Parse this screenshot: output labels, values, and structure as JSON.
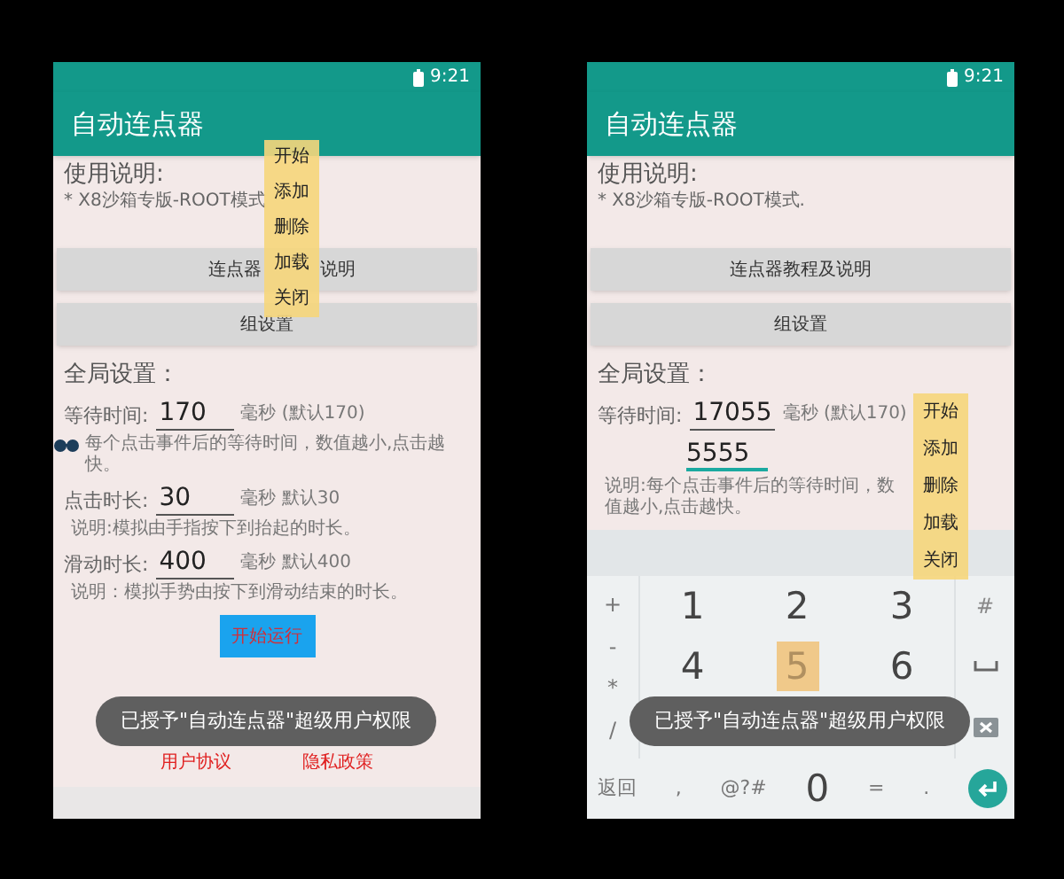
{
  "screens": [
    {
      "status_bar": {
        "time": "9:21"
      },
      "app_bar": {
        "title": "自动连点器"
      },
      "instructions": {
        "heading": "使用说明:",
        "text": "* X8沙箱专版-ROOT模式"
      },
      "buttons": [
        {
          "label_parts": [
            "连点器",
            "说明"
          ]
        },
        {
          "label_parts": [
            "组设置"
          ]
        }
      ],
      "section_title": "全局设置：",
      "settings": [
        {
          "label": "等待时间:",
          "value": "170",
          "unit": "毫秒 (默认170)",
          "note": "每个点击事件后的等待时间，数值越小,点击越快。"
        },
        {
          "label": "点击时长:",
          "value": "30",
          "unit": "毫秒 默认30",
          "note": "说明:模拟由手指按下到抬起的时长。"
        },
        {
          "label": "滑动时长:",
          "value": "400",
          "unit": "毫秒 默认400",
          "note": "说明：模拟手势由按下到滑动结束的时长。"
        }
      ],
      "start_button": "开始运行",
      "links": [
        "用户协议",
        "隐私政策"
      ],
      "float_menu": [
        "开始",
        "添加",
        "删除",
        "加载",
        "关闭"
      ],
      "toast": "已授予\"自动连点器\"超级用户权限"
    },
    {
      "status_bar": {
        "time": "9:21"
      },
      "app_bar": {
        "title": "自动连点器"
      },
      "instructions": {
        "heading": "使用说明:",
        "text": "* X8沙箱专版-ROOT模式."
      },
      "buttons": [
        {
          "label_parts": [
            "连点器教程及说明"
          ]
        },
        {
          "label_parts": [
            "组设置"
          ]
        }
      ],
      "section_title": "全局设置：",
      "settings": [
        {
          "label": "等待时间:",
          "value": "17055",
          "typed": "5555",
          "unit": "毫秒 (默认170)",
          "note": "说明:每个点击事件后的等待时间，数值越小,点击越快。"
        }
      ],
      "float_menu": [
        "开始",
        "添加",
        "删除",
        "加载",
        "关闭"
      ],
      "keyboard": {
        "symbols": [
          "+",
          "-",
          "*",
          "/"
        ],
        "digit_rows": [
          [
            {
              "label": "1",
              "pressed": false
            },
            {
              "label": "2",
              "pressed": false
            },
            {
              "label": "3",
              "pressed": false
            }
          ],
          [
            {
              "label": "4",
              "pressed": false
            },
            {
              "label": "5",
              "pressed": true
            },
            {
              "label": "6",
              "pressed": false
            }
          ]
        ],
        "side_keys": [
          {
            "kind": "text",
            "label": "#"
          },
          {
            "kind": "space"
          },
          {
            "kind": "backspace"
          }
        ],
        "bottom_row": [
          {
            "kind": "text",
            "label": "返回"
          },
          {
            "kind": "text",
            "label": ","
          },
          {
            "kind": "text",
            "label": "@?#"
          },
          {
            "kind": "digit",
            "label": "0"
          },
          {
            "kind": "text",
            "label": "="
          },
          {
            "kind": "text",
            "label": "."
          },
          {
            "kind": "enter"
          }
        ]
      },
      "toast": "已授予\"自动连点器\"超级用户权限"
    }
  ]
}
